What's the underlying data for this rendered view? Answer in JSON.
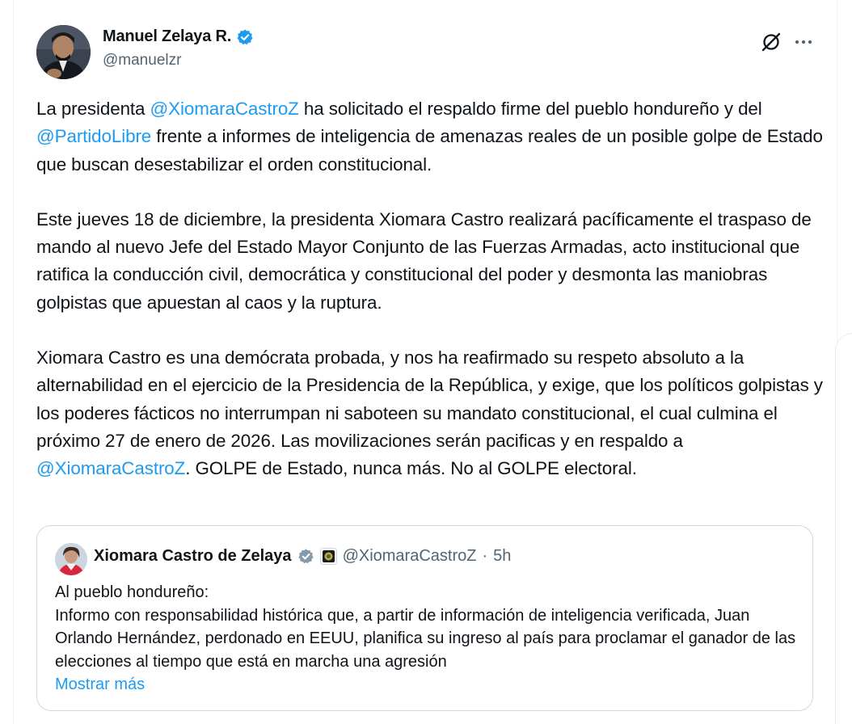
{
  "author": {
    "name": "Manuel Zelaya R.",
    "handle": "@manuelzr"
  },
  "icons": {
    "verified": "verified-badge-icon",
    "grok": "grok-icon",
    "more": "more-options-icon"
  },
  "colors": {
    "link": "#1d9bf0",
    "text": "#0f1419",
    "muted": "#536471",
    "border": "#cfd9de"
  },
  "tweet": {
    "p1": {
      "a": "La presidenta ",
      "m1": "@XiomaraCastroZ",
      "b": " ha solicitado el respaldo firme del pueblo hondureño y del ",
      "m2": "@PartidoLibre",
      "c": " frente a informes de inteligencia de amenazas reales de un posible golpe de Estado que buscan desestabilizar el orden constitucional."
    },
    "p2": "Este jueves 18 de diciembre, la presidenta Xiomara Castro realizará pacíficamente el traspaso de mando al nuevo Jefe del Estado Mayor Conjunto de las Fuerzas Armadas, acto institucional que ratifica la conducción civil, democrática y constitucional del poder y desmonta las maniobras golpistas que apuestan al caos y la ruptura.",
    "p3": {
      "a": "Xiomara Castro es una demócrata probada, y nos ha reafirmado su respeto absoluto a la alternabilidad en el ejercicio de la Presidencia de la República, y exige, que los políticos golpistas y los poderes fácticos no interrumpan ni saboteen su mandato constitucional, el cual culmina el próximo 27 de enero de 2026. Las movilizaciones serán pacificas y en respaldo a ",
      "m1": "@XiomaraCastroZ",
      "b": ". GOLPE de Estado, nunca más. No al GOLPE electoral."
    }
  },
  "quote": {
    "name": "Xiomara Castro de Zelaya",
    "handle": "@XiomaraCastroZ",
    "separator": "·",
    "time": "5h",
    "line1": "Al pueblo hondureño:",
    "line2": "Informo con responsabilidad histórica que, a partir de información de inteligencia verificada, Juan Orlando Hernández, perdonado en EEUU, planifica su ingreso al país para proclamar el ganador de las elecciones al tiempo que está en marcha una agresión",
    "show_more": "Mostrar más"
  }
}
